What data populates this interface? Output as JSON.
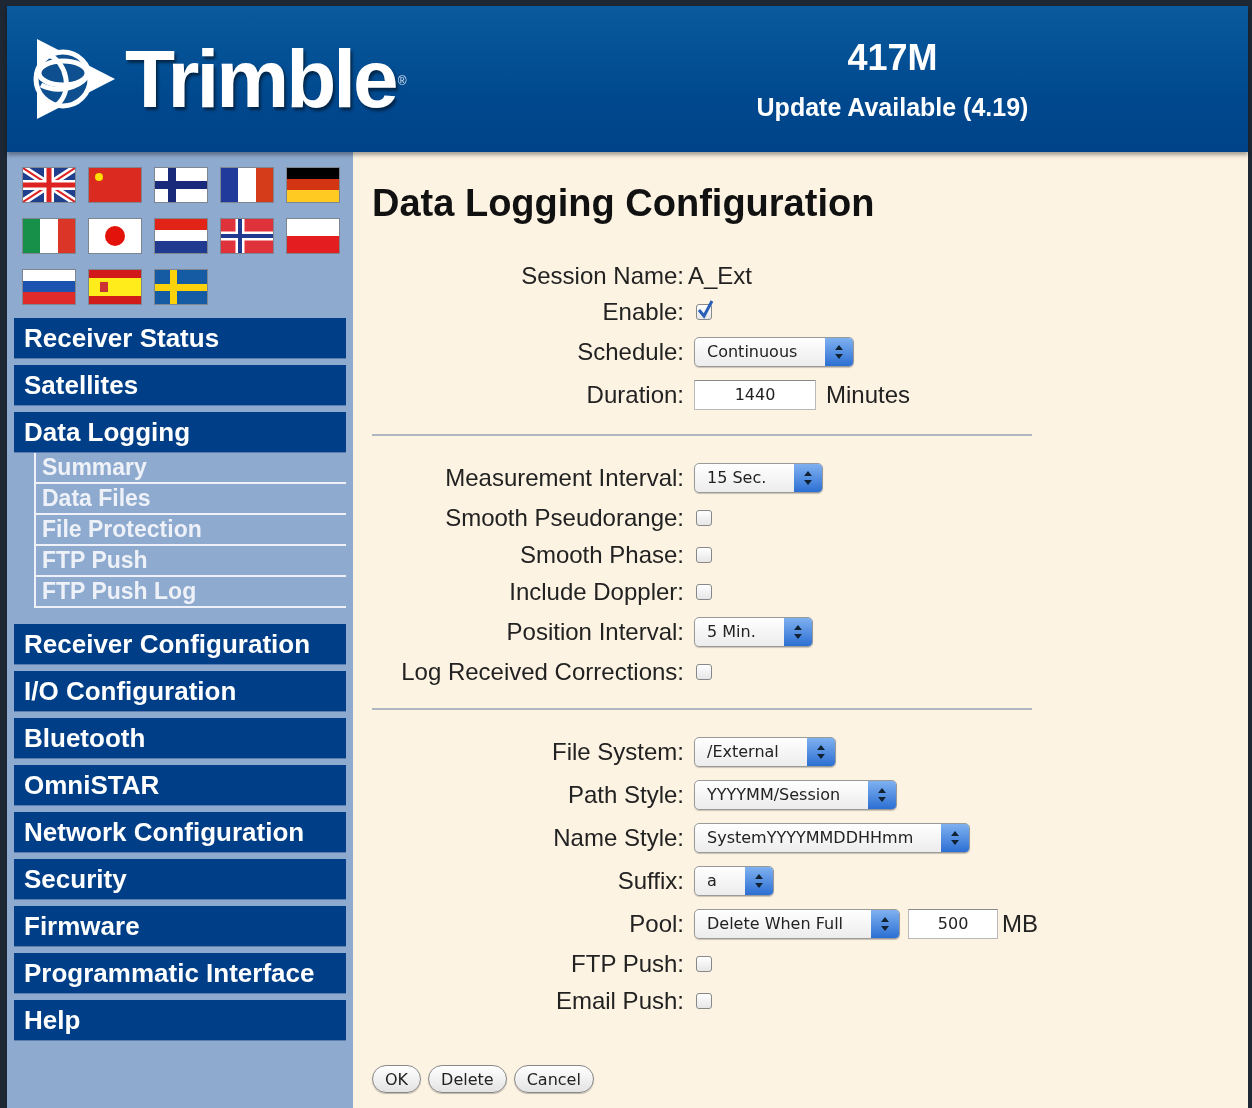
{
  "header": {
    "logo": "Trimble",
    "logo_mark": "®",
    "model": "417M",
    "update": "Update Available (4.19)"
  },
  "sidebar": {
    "items": [
      {
        "label": "Receiver Status"
      },
      {
        "label": "Satellites"
      },
      {
        "label": "Data Logging",
        "children": [
          {
            "label": "Summary"
          },
          {
            "label": "Data Files"
          },
          {
            "label": "File Protection"
          },
          {
            "label": "FTP Push"
          },
          {
            "label": "FTP Push Log"
          }
        ]
      },
      {
        "label": "Receiver Configuration"
      },
      {
        "label": "I/O Configuration"
      },
      {
        "label": "Bluetooth"
      },
      {
        "label": "OmniSTAR"
      },
      {
        "label": "Network Configuration"
      },
      {
        "label": "Security"
      },
      {
        "label": "Firmware"
      },
      {
        "label": "Programmatic Interface"
      },
      {
        "label": "Help"
      }
    ]
  },
  "page": {
    "title": "Data Logging Configuration",
    "sections": [
      {
        "rows": [
          {
            "kind": "text",
            "label": "Session Name:",
            "value": "A_Ext"
          },
          {
            "kind": "checkbox",
            "label": "Enable:",
            "checked": true
          },
          {
            "kind": "select",
            "label": "Schedule:",
            "value": "Continuous"
          },
          {
            "kind": "input",
            "label": "Duration:",
            "value": "1440",
            "unit": "Minutes"
          }
        ]
      },
      {
        "rows": [
          {
            "kind": "select",
            "label": "Measurement Interval:",
            "value": "15 Sec."
          },
          {
            "kind": "checkbox",
            "label": "Smooth Pseudorange:",
            "checked": false
          },
          {
            "kind": "checkbox",
            "label": "Smooth Phase:",
            "checked": false
          },
          {
            "kind": "checkbox",
            "label": "Include Doppler:",
            "checked": false
          },
          {
            "kind": "select",
            "label": "Position Interval:",
            "value": "5 Min."
          },
          {
            "kind": "checkbox",
            "label": "Log Received Corrections:",
            "checked": false
          }
        ]
      },
      {
        "rows": [
          {
            "kind": "select",
            "label": "File System:",
            "value": "/External"
          },
          {
            "kind": "select",
            "label": "Path Style:",
            "value": "YYYYMM/Session"
          },
          {
            "kind": "select",
            "label": "Name Style:",
            "value": "SystemYYYYMMDDHHmm"
          },
          {
            "kind": "select",
            "label": "Suffix:",
            "value": "a"
          },
          {
            "kind": "select_input",
            "label": "Pool:",
            "value": "Delete When Full",
            "input": "500",
            "unit": "MB"
          },
          {
            "kind": "checkbox",
            "label": "FTP Push:",
            "checked": false
          },
          {
            "kind": "checkbox",
            "label": "Email Push:",
            "checked": false
          }
        ]
      }
    ],
    "buttons": [
      "OK",
      "Delete",
      "Cancel"
    ]
  }
}
